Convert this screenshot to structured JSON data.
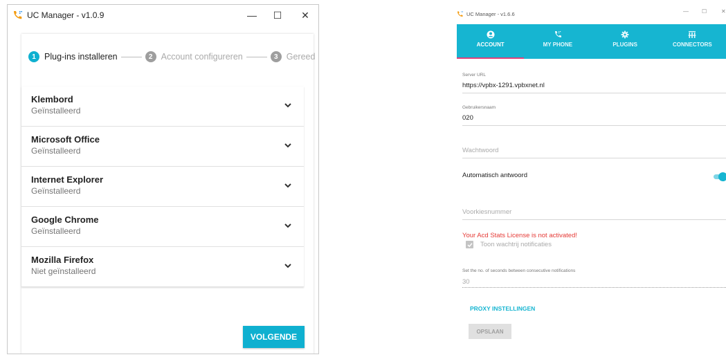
{
  "left_window": {
    "title": "UC Manager - v1.0.9",
    "controls": {
      "minimize": "—",
      "maximize": "☐",
      "close": "✕"
    },
    "stepper": [
      {
        "num": "1",
        "label": "Plug-ins installeren"
      },
      {
        "num": "2",
        "label": "Account configureren"
      },
      {
        "num": "3",
        "label": "Gereed"
      }
    ],
    "plugins": [
      {
        "name": "Klembord",
        "status": "Geïnstalleerd"
      },
      {
        "name": "Microsoft Office",
        "status": "Geïnstalleerd"
      },
      {
        "name": "Internet Explorer",
        "status": "Geïnstalleerd"
      },
      {
        "name": "Google Chrome",
        "status": "Geïnstalleerd"
      },
      {
        "name": "Mozilla Firefox",
        "status": "Niet geïnstalleerd"
      }
    ],
    "next_button": "VOLGENDE"
  },
  "right_window": {
    "title": "UC Manager - v1.6.6",
    "controls": {
      "minimize": "—",
      "maximize": "☐",
      "close": "✕"
    },
    "tabs": [
      {
        "label": "ACCOUNT",
        "icon": "account-circle-icon"
      },
      {
        "label": "MY PHONE",
        "icon": "phone-icon"
      },
      {
        "label": "PLUGINS",
        "icon": "gear-icon"
      },
      {
        "label": "CONNECTORS",
        "icon": "connectors-icon"
      }
    ],
    "server_url": {
      "label": "Server URL",
      "value": "https://vpbx-1291.vpbxnet.nl"
    },
    "username": {
      "label": "Gebruikersnaam",
      "value": "020"
    },
    "password": {
      "placeholder": "Wachtwoord"
    },
    "auto_answer": {
      "label": "Automatisch antwoord",
      "on": true
    },
    "prefix": {
      "placeholder": "Voorkiesnummer"
    },
    "license_warning": "Your Acd Stats License is not activated!",
    "queue_notifications": {
      "label": "Toon wachtrij notificaties",
      "checked": true
    },
    "seconds": {
      "label": "Set the no. of seconds between consecutive notifications",
      "value": "30"
    },
    "proxy_link": "PROXY INSTELLINGEN",
    "save_button": "OPSLAAN"
  },
  "colors": {
    "accent": "#16b5d1",
    "warning": "#e53935",
    "tab_indicator": "#e0407a",
    "icon_orange": "#f39c12"
  }
}
